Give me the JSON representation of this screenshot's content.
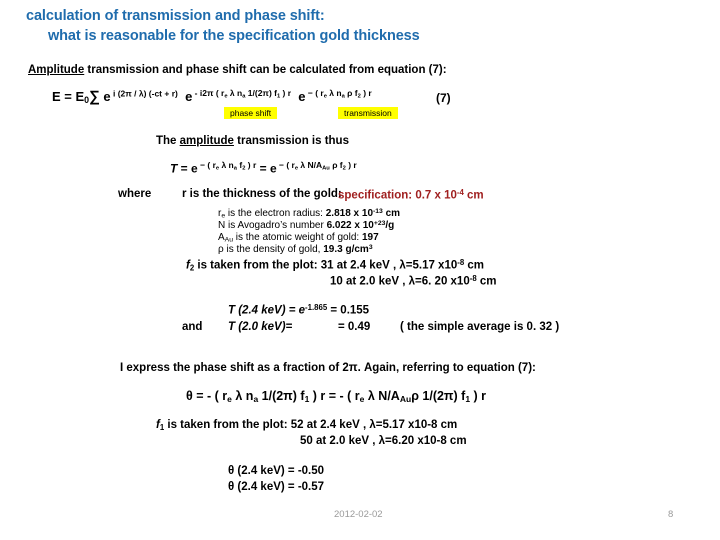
{
  "slide": {
    "title_line1": "calculation of transmission and phase shift:",
    "title_line2": "what is reasonable for the specification gold thickness",
    "title_color": "#1f6cad"
  },
  "intro": {
    "underlined_word": "Amplitude",
    "rest": " transmission and phase shift can be calculated from equation (7):"
  },
  "equation7": {
    "lhs": "E  =  E",
    "lhs_sub": "0",
    "sigma": "∑",
    "term1_base": " e",
    "term1_exp": " i (2π / λ) (-ct + r)",
    "term2_base": "e",
    "term2_exp": " - i2π ( r",
    "term2_exp_sub1": "e",
    "term2_exp_mid": " λ n",
    "term2_exp_sub2": "a",
    "term2_exp_mid2": " 1/(2π) f",
    "term2_exp_sub3": "1",
    "term2_exp_tail": " ) r",
    "term3_base": "e",
    "term3_exp": " − ( r",
    "term3_exp_sub1": "e",
    "term3_exp_mid": " λ n",
    "term3_exp_sub2": "a",
    "term3_exp_mid2": " ρ f",
    "term3_exp_sub3": "2",
    "term3_exp_tail": " ) r",
    "number": "(7)",
    "highlight_phase": "phase shift",
    "highlight_transmission": "transmission",
    "highlight_color": "#ffff00"
  },
  "amplitude_section": {
    "heading_pre": "The ",
    "heading_underlined": "amplitude",
    "heading_post": " transmission is thus",
    "t_symbol": "T",
    "t_eq1": "   =  e",
    "t_eq1_exp_a": " − ( r",
    "t_eq1_exp_sub1": "e",
    "t_eq1_exp_b": " λ n",
    "t_eq1_exp_sub2": "a",
    "t_eq1_exp_c": " f",
    "t_eq1_exp_sub3": "2",
    "t_eq1_exp_d": " ) r",
    "t_eq2": "  =  e",
    "t_eq2_exp_a": " − ( r",
    "t_eq2_exp_sub1": "e",
    "t_eq2_exp_b": " λ N/A",
    "t_eq2_exp_sub2": "Au",
    "t_eq2_exp_c": " ρ f",
    "t_eq2_exp_sub3": "2",
    "t_eq2_exp_d": " ) r"
  },
  "where_block": {
    "label": "where",
    "thickness_text": "r is the thickness of the gold:",
    "spec_pre": "specification: 0.7 x 10",
    "spec_exp": "-4",
    "spec_post": " cm"
  },
  "constants": [
    {
      "symbol": "r",
      "symbol_sub": "e",
      "text": " is the electron radius: ",
      "value": "2.818 x 10",
      "exp": "-13",
      "unit": " cm"
    },
    {
      "symbol": "N",
      "symbol_sub": "",
      "text": " is Avogadro’s number  ",
      "value": "6.022 x 10",
      "exp": "+23",
      "unit": "/g"
    },
    {
      "symbol": "A",
      "symbol_sub": "Au",
      "text": " is the atomic weight of gold: ",
      "value": "197",
      "exp": "",
      "unit": ""
    },
    {
      "symbol": "ρ",
      "symbol_sub": "",
      "text": " is the density of gold, ",
      "value": "19.3 g/cm",
      "exp": "3",
      "unit": ""
    }
  ],
  "f2_block": {
    "symbol": "f",
    "symbol_sub": "2",
    "intro": " is taken from the plot: ",
    "line1_value": "31 at 2.4 keV",
    "line1_lambda_pre": " , λ=5.17 x10",
    "line1_lambda_exp": "-8",
    "line1_lambda_post": " cm",
    "line2_value": "10 at 2.0 keV",
    "line2_lambda_pre": " , λ=6. 20 x10",
    "line2_lambda_exp": "-8",
    "line2_lambda_post": " cm"
  },
  "t_results": {
    "t24_label": "T (2.4 keV) = e",
    "t24_exp": "-1.865",
    "t24_value": " = 0.155",
    "and_label": "and",
    "t20_label": "T (2.0 keV)=",
    "t20_value": "= 0.49",
    "average_note": "( the simple average is 0. 32 )"
  },
  "phase_block": {
    "intro": "I express the phase shift as a fraction of 2π.   Again, referring to equation (7):",
    "theta_symbol": "θ",
    "eq_part1": "  =  - ( r",
    "eq_part1_sub": "e",
    "eq_part2": " λ  n",
    "eq_part2_sub": "a",
    "eq_part3": " 1/(2π) f",
    "eq_part3_sub": "1",
    "eq_part4": " )  r",
    "eq_part5": "    =  - ( r",
    "eq_part5_sub": "e",
    "eq_part6": " λ   N/A",
    "eq_part6_sub": "Au",
    "eq_part7": "ρ  1/(2π) f",
    "eq_part7_sub": "1",
    "eq_part8": " )  r"
  },
  "f1_block": {
    "symbol": "f",
    "symbol_sub": "1",
    "intro": " is taken from the plot: ",
    "line1": "52 at 2.4 keV  , λ=5.17 x10-8 cm",
    "line2": "50 at 2.0 keV , λ=6.20 x10-8 cm"
  },
  "theta_results": {
    "line1": "θ (2.4 keV) = -0.50",
    "line2": "θ (2.4 keV) = -0.57"
  },
  "footer": {
    "date": "2012-02-02",
    "page": "8"
  }
}
